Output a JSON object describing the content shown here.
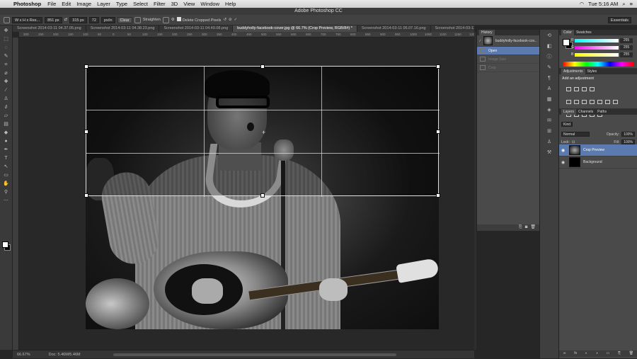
{
  "menubar": {
    "app_name": "Photoshop",
    "items": [
      "File",
      "Edit",
      "Image",
      "Layer",
      "Type",
      "Select",
      "Filter",
      "3D",
      "View",
      "Window",
      "Help"
    ],
    "right": {
      "day_time": "Tue 5:16 AM"
    }
  },
  "window_title": "Adobe Photoshop CC",
  "options": {
    "ratio_label": "W x H x Res...",
    "width_value": "851 px",
    "height_value": "315 px",
    "resolution_value": "72",
    "resolution_unit": "px/in",
    "clear_label": "Clear",
    "straighten_label": "Straighten",
    "delete_cropped_label": "Delete Cropped Pixels",
    "workspace_label": "Essentials"
  },
  "tabs": [
    {
      "label": "Screenshot 2014-03-11 04.37.05.png"
    },
    {
      "label": "Screenshot 2014-03-11 04.38.23.png"
    },
    {
      "label": "Screenshot 2014-03-11 04.49.08.png"
    },
    {
      "label": "buddyholly-facebook-cover.jpg @ 66.7% (Crop Preview, RGB/8#) *"
    },
    {
      "label": "Screenshot 2014-03-11 05.07.16.png"
    },
    {
      "label": "Screenshot 2014-03-11 05..."
    }
  ],
  "ruler_ticks": [
    "300",
    "250",
    "200",
    "150",
    "100",
    "50",
    "0",
    "50",
    "100",
    "150",
    "200",
    "250",
    "300",
    "350",
    "400",
    "450",
    "500",
    "550",
    "600",
    "650",
    "700",
    "750",
    "800",
    "850",
    "900",
    "950",
    "1000",
    "1050",
    "1100",
    "1150",
    "1200"
  ],
  "status": {
    "zoom": "66.67%",
    "doc": "Doc: 5.46M/5.46M"
  },
  "history": {
    "tab_label": "History",
    "snapshot_label": "buddyholly-facebook-cov...",
    "items": [
      {
        "label": "Open",
        "selected": true
      },
      {
        "label": "Image Size",
        "selected": false
      },
      {
        "label": "Crop",
        "selected": false
      }
    ]
  },
  "color_panel": {
    "tabs": [
      "Color",
      "Swatches"
    ],
    "channels": [
      {
        "label": "R",
        "value": "255",
        "color": "#ff3b3b"
      },
      {
        "label": "G",
        "value": "255",
        "color": "#3bff3b"
      },
      {
        "label": "B",
        "value": "255",
        "color": "#3b6bff"
      }
    ]
  },
  "adjustments": {
    "tabs": [
      "Adjustments",
      "Styles"
    ],
    "title": "Add an adjustment"
  },
  "layers": {
    "tabs": [
      "Layers",
      "Channels",
      "Paths"
    ],
    "kind_label": "Kind",
    "blend_mode": "Normal",
    "opacity_label": "Opacity:",
    "opacity_value": "100%",
    "lock_label": "Lock:",
    "fill_label": "Fill:",
    "fill_value": "100%",
    "items": [
      {
        "name": "Crop Preview",
        "selected": true
      },
      {
        "name": "Background",
        "selected": false
      }
    ]
  }
}
